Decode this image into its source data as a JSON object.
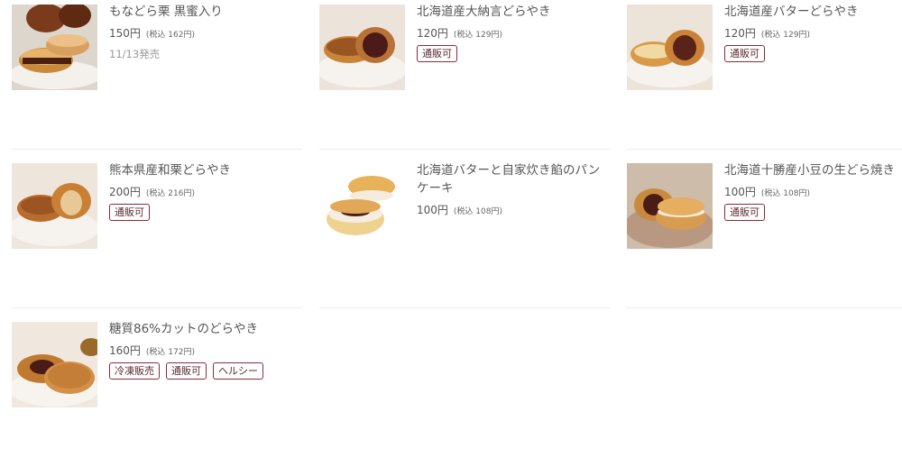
{
  "products": [
    {
      "name": "もなどら栗 黒蜜入り",
      "price": "150円",
      "tax_price": "(税込 162円)",
      "release": "11/13発売",
      "tags": []
    },
    {
      "name": "北海道産大納言どらやき",
      "price": "120円",
      "tax_price": "(税込 129円)",
      "tags": [
        "通販可"
      ]
    },
    {
      "name": "北海道産バターどらやき",
      "price": "120円",
      "tax_price": "(税込 129円)",
      "tags": [
        "通販可"
      ]
    },
    {
      "name": "熊本県産和栗どらやき",
      "price": "200円",
      "tax_price": "(税込 216円)",
      "tags": [
        "通販可"
      ]
    },
    {
      "name": "北海道バターと自家炊き餡のパンケーキ",
      "price": "100円",
      "tax_price": "(税込 108円)",
      "tags": []
    },
    {
      "name": "北海道十勝産小豆の生どら焼き",
      "price": "100円",
      "tax_price": "(税込 108円)",
      "tags": [
        "通販可"
      ]
    },
    {
      "name": "糖質86%カットのどらやき",
      "price": "160円",
      "tax_price": "(税込 172円)",
      "tags": [
        "冷凍販売",
        "通販可",
        "ヘルシー"
      ]
    }
  ],
  "colors": {
    "tag_border": "#8a2b3b",
    "divider": "#ececec",
    "text": "#555555"
  }
}
